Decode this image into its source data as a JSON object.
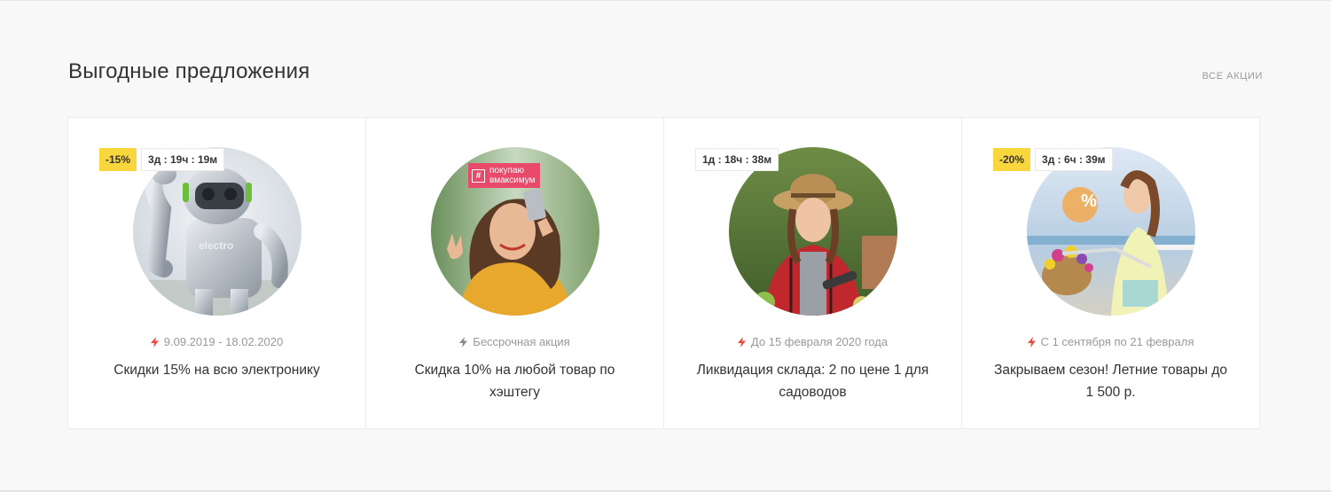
{
  "section": {
    "title": "Выгодные предложения",
    "all_link": "ВСЕ АКЦИИ"
  },
  "colors": {
    "accent_yellow": "#f9d63c",
    "bolt_active": "#e84c3d",
    "bolt_neutral": "#8a8a8a"
  },
  "offers": [
    {
      "discount": "-15%",
      "timer": "3д : 19ч : 19м",
      "date": "9.09.2019 - 18.02.2020",
      "title": "Скидки 15% на всю электронику",
      "icon": "lightning-icon",
      "image": "robot-electronics-photo"
    },
    {
      "discount": "",
      "timer": "",
      "date": "Бессрочная акция",
      "title": "Скидка 10% на любой товар по хэштегу",
      "icon": "lightning-icon",
      "image": "selfie-hashtag-photo",
      "image_text": {
        "tag_symbol": "#",
        "line1": "покупаю",
        "line2": "вмаксимум"
      }
    },
    {
      "discount": "",
      "timer": "1д : 18ч : 38м",
      "date": "До 15 февраля 2020 года",
      "title": "Ликвидация склада: 2 по цене 1 для садоводов",
      "icon": "lightning-icon",
      "image": "gardener-photo"
    },
    {
      "discount": "-20%",
      "timer": "3д : 6ч : 39м",
      "date": "С 1 сентября по 21 февраля",
      "title": "Закрываем сезон! Летние товары до 1 500 р.",
      "icon": "lightning-icon",
      "image": "summer-bicycle-photo",
      "image_text": {
        "balloon": "%"
      }
    }
  ]
}
